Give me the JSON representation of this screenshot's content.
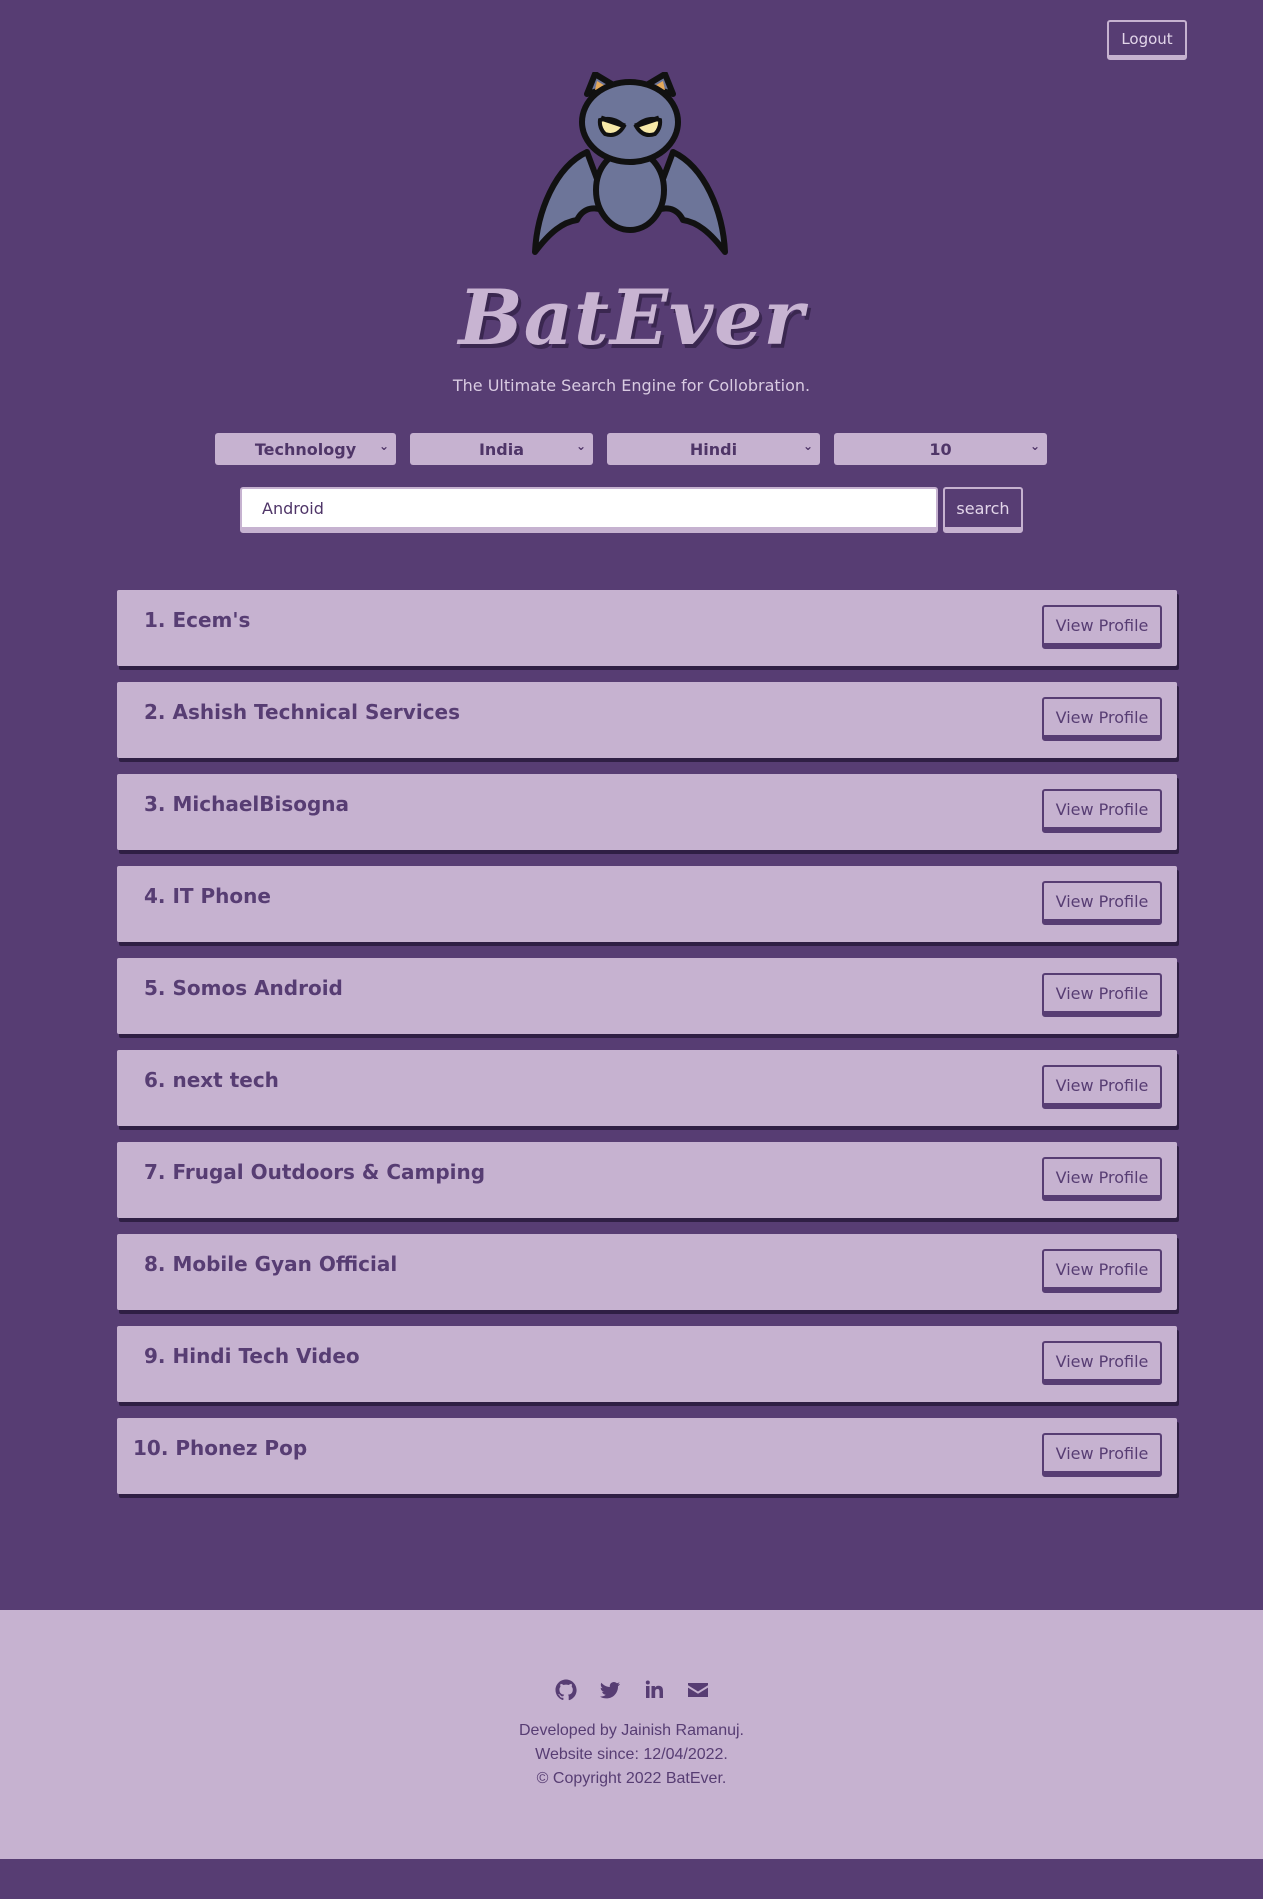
{
  "header": {
    "logout_label": "Logout"
  },
  "brand": {
    "name": "BatEver",
    "tagline": "The Ultimate Search Engine for Collobration."
  },
  "filters": {
    "category": "Technology",
    "country": "India",
    "language": "Hindi",
    "count": "10"
  },
  "search": {
    "value": "Android",
    "button_label": "search"
  },
  "results": [
    {
      "title": "1. Ecem's",
      "button": "View Profile"
    },
    {
      "title": "2. Ashish Technical Services",
      "button": "View Profile"
    },
    {
      "title": "3. MichaelBisogna",
      "button": "View Profile"
    },
    {
      "title": "4. IT Phone",
      "button": "View Profile"
    },
    {
      "title": "5. Somos Android",
      "button": "View Profile"
    },
    {
      "title": "6. next tech",
      "button": "View Profile"
    },
    {
      "title": "7. Frugal Outdoors & Camping",
      "button": "View Profile"
    },
    {
      "title": "8. Mobile Gyan Official",
      "button": "View Profile"
    },
    {
      "title": "9. Hindi Tech Video",
      "button": "View Profile"
    },
    {
      "title": "10. Phonez Pop",
      "button": "View Profile"
    }
  ],
  "footer": {
    "social_icons": [
      "github-icon",
      "twitter-icon",
      "linkedin-icon",
      "envelope-icon"
    ],
    "developer": "Developed by Jainish Ramanuj.",
    "since": "Website since: 12/04/2022.",
    "copyright": "© Copyright 2022 BatEver."
  },
  "colors": {
    "background": "#573d73",
    "accent": "#c6b2d0"
  }
}
